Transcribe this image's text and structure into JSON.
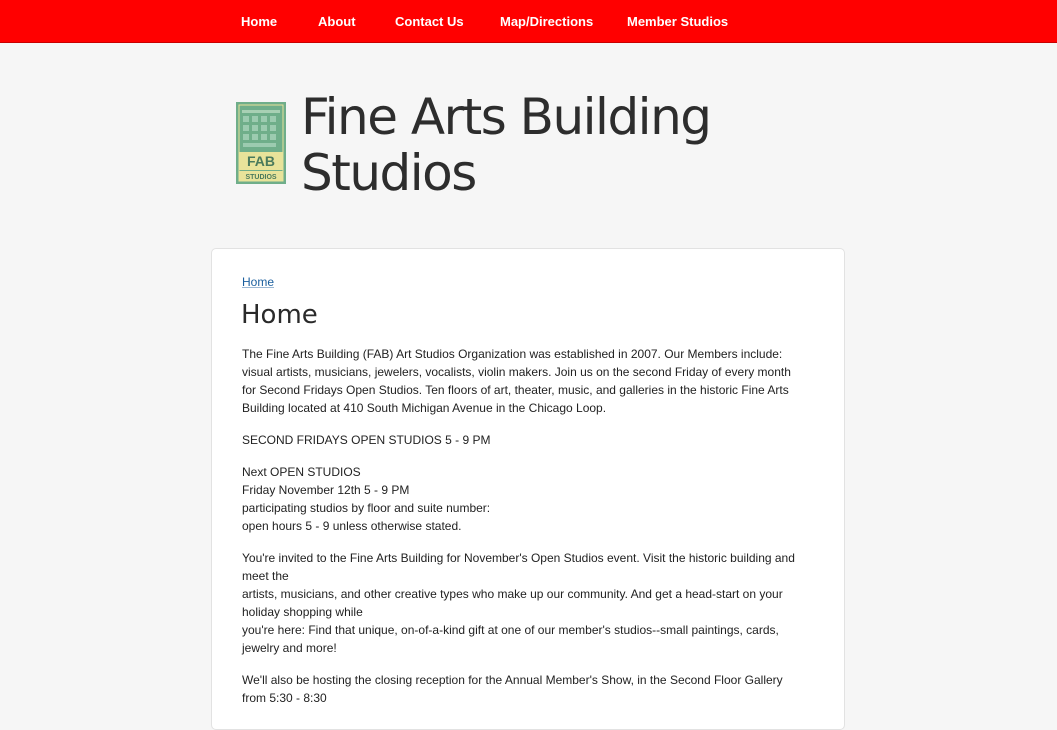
{
  "nav": {
    "items": [
      "Home",
      "About",
      "Contact Us",
      "Map/Directions",
      "Member Studios"
    ]
  },
  "header": {
    "logo_icon": "fab-studios-logo",
    "logo_text": "FAB",
    "logo_subtext": "STUDIOS",
    "site_name_line1": "Fine Arts Building",
    "site_name_line2": "Studios"
  },
  "main": {
    "breadcrumb": "Home",
    "title": "Home",
    "paragraphs": [
      {
        "lines": [
          "The Fine Arts Building (FAB) Art Studios Organization was established in 2007. Our Members include:",
          "visual artists, musicians, jewelers, vocalists, violin makers. Join us on the second Friday of every month",
          "for Second Fridays Open Studios. Ten floors of art, theater, music, and galleries in the historic Fine Arts",
          "Building located at 410 South Michigan Avenue in the Chicago Loop."
        ]
      },
      {
        "lines": [
          "SECOND FRIDAYS OPEN STUDIOS 5 - 9 PM"
        ]
      },
      {
        "lines": [
          "Next OPEN STUDIOS",
          "Friday November 12th 5 - 9 PM",
          "participating studios by floor and suite number:",
          "open hours 5 - 9 unless otherwise stated."
        ]
      },
      {
        "lines": [
          "You're invited to the Fine Arts Building for November's Open Studios event. Visit the historic building and",
          "meet the",
          "artists, musicians, and other creative types who make up our community. And get a head-start on your",
          "holiday shopping while",
          "you're here: Find that unique, on-of-a-kind gift at one of our member's studios--small paintings, cards,",
          "jewelry and more!"
        ]
      },
      {
        "lines": [
          "We'll also be hosting the closing reception for the Annual Member's Show, in the Second Floor Gallery",
          "from 5:30 - 8:30"
        ]
      }
    ]
  },
  "colors": {
    "nav_background": "#ff0000",
    "link": "#1b5f9e",
    "logo_green": "#6fae8a",
    "logo_yellow": "#e8e39a"
  }
}
